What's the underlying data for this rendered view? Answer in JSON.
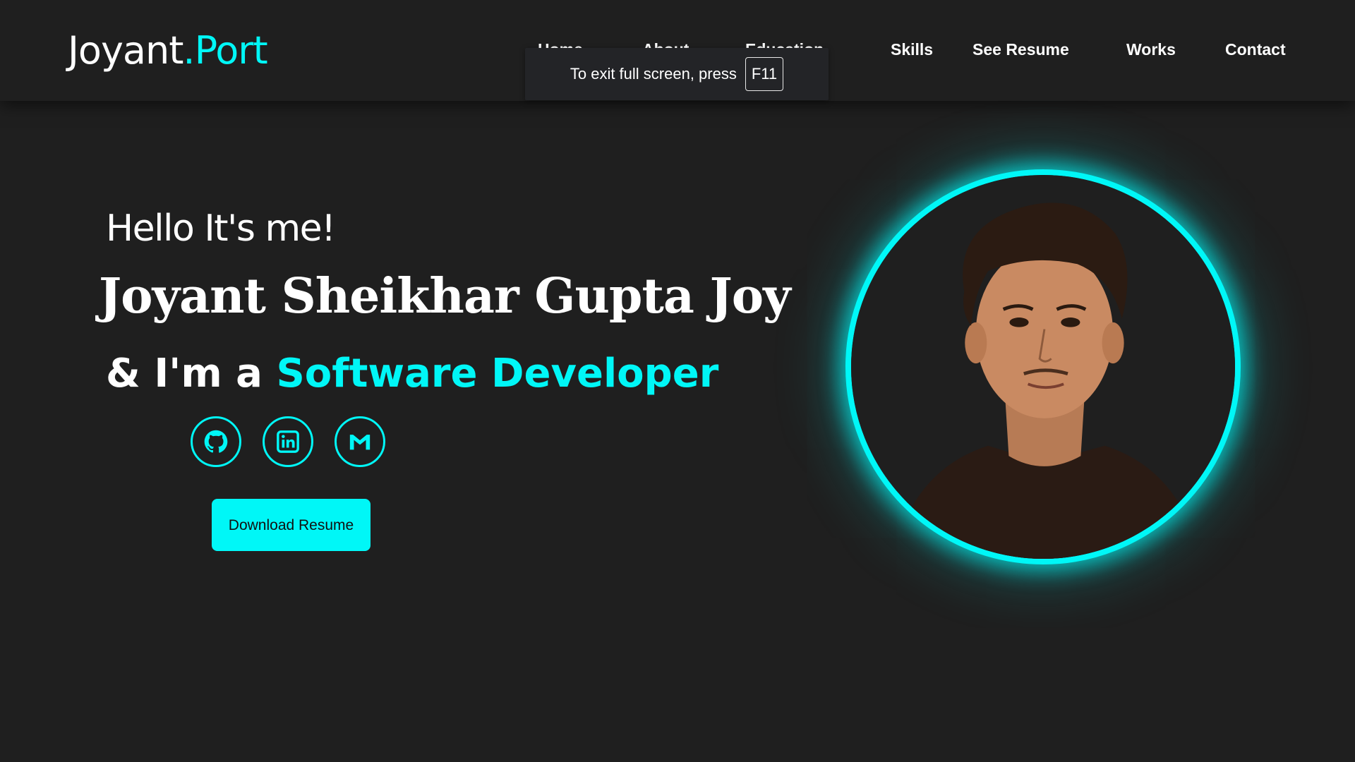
{
  "header": {
    "logo_main": "Joyant",
    "logo_accent": ".Port",
    "nav": [
      {
        "label": "Home"
      },
      {
        "label": "About"
      },
      {
        "label": "Education"
      },
      {
        "label": "Skills"
      },
      {
        "label": "See Resume"
      },
      {
        "label": "Works"
      },
      {
        "label": "Contact"
      }
    ]
  },
  "fullscreen_toast": {
    "text": "To exit full screen, press",
    "key": "F11"
  },
  "hero": {
    "greeting": "Hello It's me!",
    "name": "Joyant Sheikhar Gupta Joy",
    "role_prefix": "& I'm a ",
    "role_title": "Software Developer",
    "socials": [
      {
        "icon": "github-icon"
      },
      {
        "icon": "linkedin-icon"
      },
      {
        "icon": "gmail-icon"
      }
    ],
    "download_label": "Download Resume"
  },
  "colors": {
    "accent": "#00f7f7",
    "background": "#1f1f1f",
    "text": "#ffffff"
  }
}
